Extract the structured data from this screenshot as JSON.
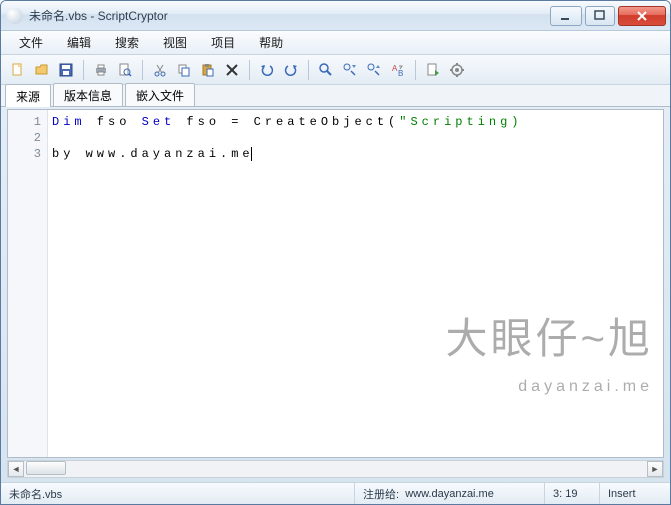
{
  "window": {
    "title": "未命名.vbs - ScriptCryptor"
  },
  "menu": {
    "file": "文件",
    "edit": "编辑",
    "search": "搜索",
    "view": "视图",
    "project": "项目",
    "help": "帮助"
  },
  "tabs": {
    "source": "来源",
    "version": "版本信息",
    "embed": "嵌入文件"
  },
  "code": {
    "lines": [
      "1",
      "2",
      "3"
    ],
    "line1_kw1": "Dim",
    "line1_var1": " fso ",
    "line1_kw2": "Set",
    "line1_rest": " fso = CreateObject(",
    "line1_str": "\"Scripting)",
    "line3": "by www.dayanzai.me"
  },
  "watermark": {
    "main": "大眼仔~旭",
    "sub": "dayanzai.me"
  },
  "status": {
    "filename": "未命名.vbs",
    "reg_label": "注册给:",
    "reg_value": "www.dayanzai.me",
    "pos": "3: 19",
    "mode": "Insert"
  }
}
